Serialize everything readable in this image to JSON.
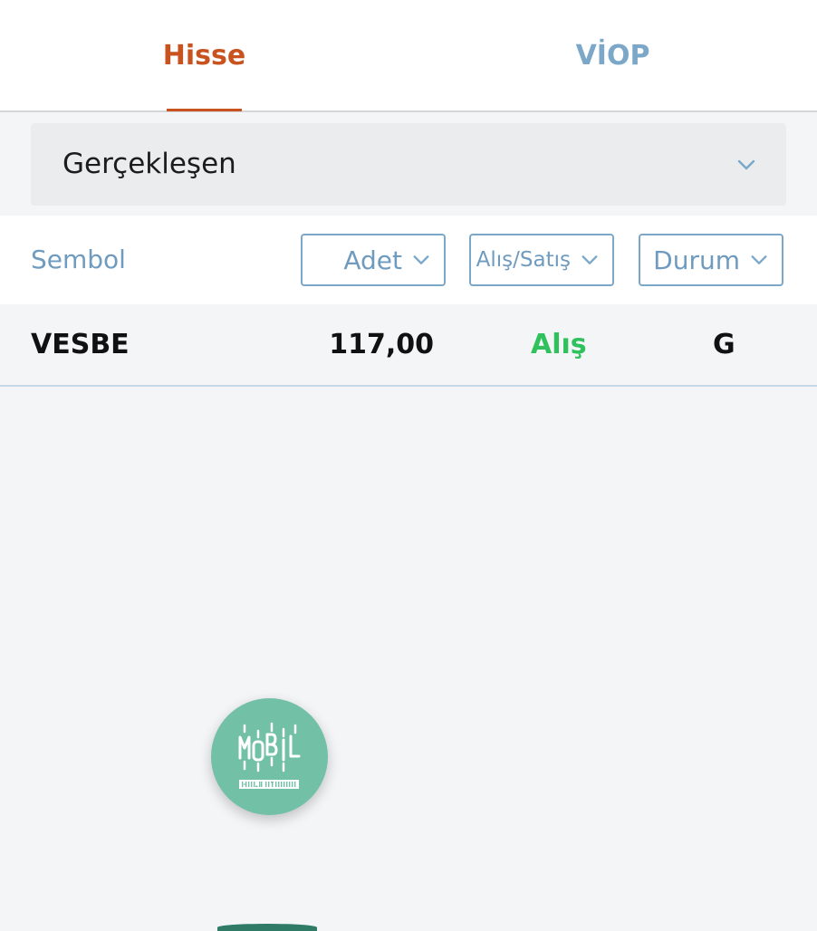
{
  "tabs": {
    "hisse": "Hisse",
    "viop": "VİOP"
  },
  "filter": {
    "selected": "Gerçekleşen"
  },
  "table": {
    "symbol_header": "Sembol",
    "filters": {
      "quantity": "Adet",
      "side": "Alış/Satış",
      "status": "Durum"
    },
    "rows": [
      {
        "symbol": "VESBE",
        "quantity": "117,00",
        "side": "Alış",
        "status": "G"
      }
    ]
  },
  "fab": {
    "logo_text": "MOBIL",
    "logo_subtext": "HALK YATIRIM"
  },
  "colors": {
    "active_tab": "#c9531f",
    "inactive_tab": "#7ba7c9",
    "buy": "#2ec15c",
    "fab": "#72c0a6"
  },
  "icons": {
    "dropdown": "chevron-down-icon",
    "fab": "mobil-logo-icon"
  }
}
